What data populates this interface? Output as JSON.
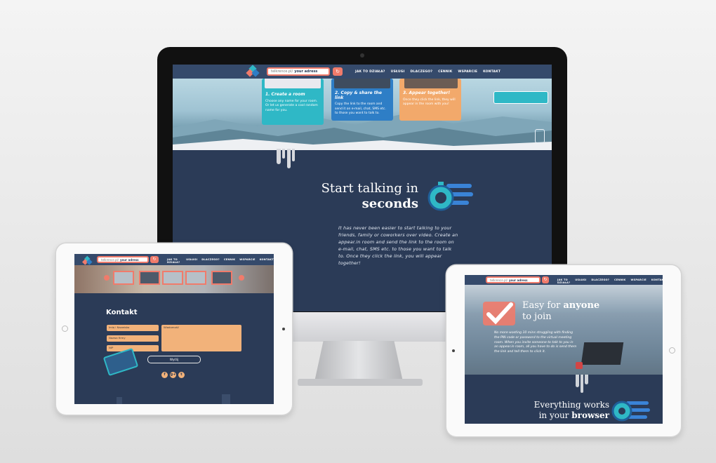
{
  "url_bar": {
    "prefix": "telkrence.pl/",
    "value": "your adress"
  },
  "nav": [
    "JAK TO DZIAŁA?",
    "USŁUGI",
    "DLACZEGO?",
    "CENNIK",
    "WSPARCIE",
    "KONTAKT"
  ],
  "desktop": {
    "steps": [
      {
        "title": "1. Create a room",
        "text": "Choose any name for your room. Or let us generate a cool random name for you."
      },
      {
        "title": "2. Copy & share the link",
        "text": "Copy the link to the room and send it on e-mail, chat, SMS etc. to those you want to talk to."
      },
      {
        "title": "3. Appear together!",
        "text": "Once they click the link, they will appear in the room with you!"
      }
    ],
    "hero_title_line1": "Start talking in",
    "hero_title_line2": "seconds",
    "hero_body": "It has never been easier to start talking to your friends, family or coworkers over video. Create an appear.in room and send the link to the room on e-mail, chat, SMS etc. to those you want to talk to. Once they click the link, you will appear together!"
  },
  "tablet_left": {
    "contact_title": "Kontakt",
    "fields": [
      "Imię i Nazwisko",
      "Nazwa firmy",
      "NIP"
    ],
    "message_placeholder": "Wiadomość",
    "submit_label": "Wyślij",
    "social": [
      "f",
      "g+",
      "t"
    ]
  },
  "tablet_right": {
    "feature_title_pre": "Easy for ",
    "feature_title_bold": "anyone",
    "feature_title_line2": "to join",
    "feature_body": "No more wasting 10 mins struggling with finding the PIN code or password to the virtual meeting room. When you invite someone to talk to you in an appear.in room, all you have to do is send them the link and tell them to click it.",
    "bottom_title_line1": "Everything works",
    "bottom_title_pre": "in your ",
    "bottom_title_bold": "browser"
  },
  "colors": {
    "navy": "#2b3b57",
    "coral": "#f07b6b",
    "teal": "#2fb8c6",
    "blue": "#2e7ec6",
    "peach": "#f2b27a"
  }
}
